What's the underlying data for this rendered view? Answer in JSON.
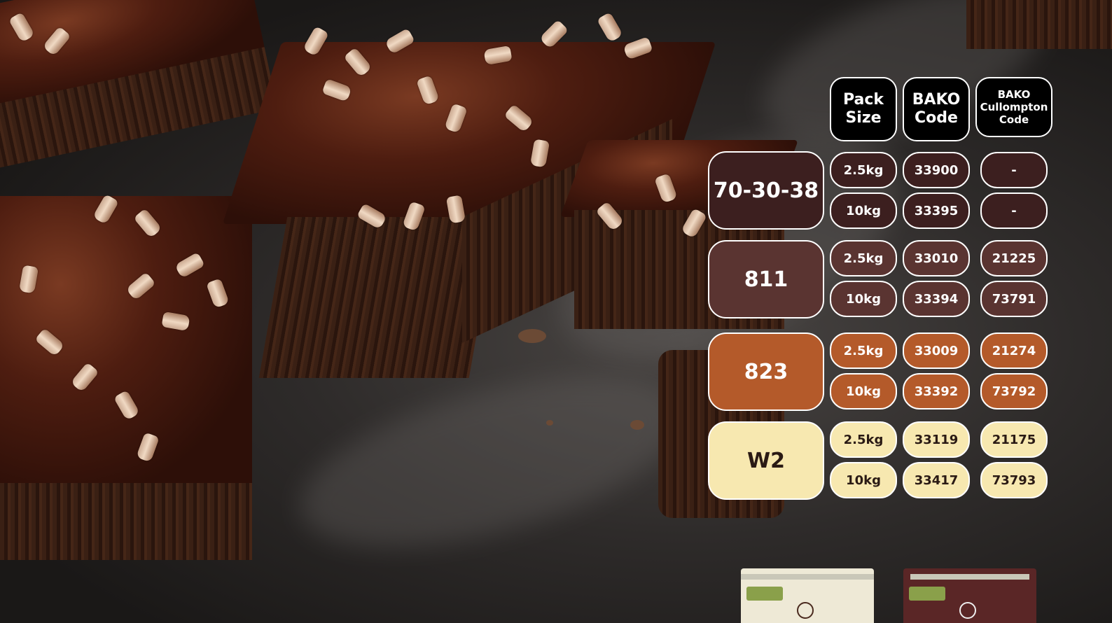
{
  "headers": {
    "pack_size": "Pack Size",
    "bako_code": "BAKO Code",
    "cullompton": "BAKO Cullompton Code"
  },
  "products": [
    {
      "name": "70-30-38",
      "rows": [
        {
          "pack": "2.5kg",
          "bako": "33900",
          "cullompton": "-"
        },
        {
          "pack": "10kg",
          "bako": "33395",
          "cullompton": "-"
        }
      ]
    },
    {
      "name": "811",
      "rows": [
        {
          "pack": "2.5kg",
          "bako": "33010",
          "cullompton": "21225"
        },
        {
          "pack": "10kg",
          "bako": "33394",
          "cullompton": "73791"
        }
      ]
    },
    {
      "name": "823",
      "rows": [
        {
          "pack": "2.5kg",
          "bako": "33009",
          "cullompton": "21274"
        },
        {
          "pack": "10kg",
          "bako": "33392",
          "cullompton": "73792"
        }
      ]
    },
    {
      "name": "W2",
      "rows": [
        {
          "pack": "2.5kg",
          "bako": "33119",
          "cullompton": "21175"
        },
        {
          "pack": "10kg",
          "bako": "33417",
          "cullompton": "73793"
        }
      ]
    }
  ],
  "colors": {
    "header_bg": "#000000",
    "product_70_30_38": "#3c1f1f",
    "product_811": "#5a3431",
    "product_823": "#b45a2a",
    "product_w2": "#f7e8b0",
    "outline": "#ffffff"
  }
}
